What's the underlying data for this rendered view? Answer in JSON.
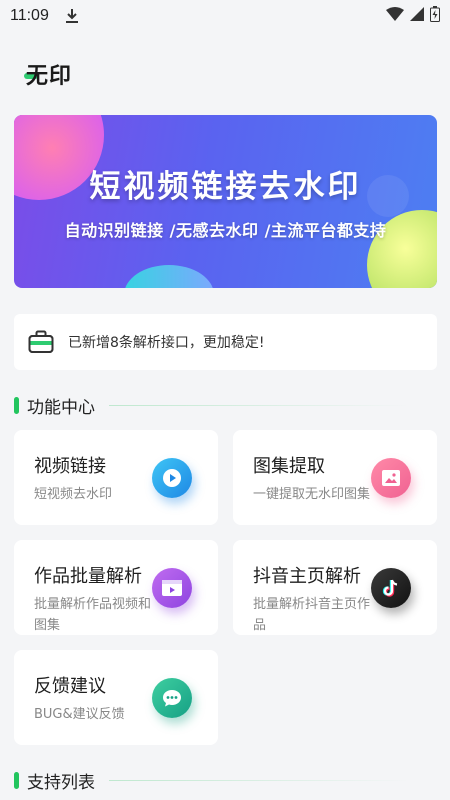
{
  "status_bar": {
    "time": "11:09",
    "icons": [
      "download-icon",
      "wifi-icon",
      "signal-icon",
      "battery-icon"
    ]
  },
  "app": {
    "logo_text": "无印"
  },
  "banner": {
    "title": "短视频链接去水印",
    "subtitle": "自动识别链接 /无感去水印 /主流平台都支持"
  },
  "notice": {
    "text": "已新增8条解析接口，更加稳定!",
    "icon": "briefcase-icon"
  },
  "sections": {
    "functions": "功能中心",
    "support_list": "支持列表"
  },
  "features": [
    {
      "title": "视频链接",
      "desc": "短视频去水印",
      "icon": "play-icon",
      "color": "#1e88e5"
    },
    {
      "title": "图集提取",
      "desc": "一键提取无水印图集",
      "icon": "image-icon",
      "color": "#f06292"
    },
    {
      "title": "作品批量解析",
      "desc": "批量解析作品视频和图集",
      "icon": "film-icon",
      "color": "#8e44e0"
    },
    {
      "title": "抖音主页解析",
      "desc": "批量解析抖音主页作品",
      "icon": "tiktok-icon",
      "color": "#111111"
    },
    {
      "title": "反馈建议",
      "desc": "BUG&建议反馈",
      "icon": "chat-icon",
      "color": "#16a085"
    }
  ],
  "colors": {
    "accent": "#22c55e",
    "background": "#f4f5f7"
  }
}
